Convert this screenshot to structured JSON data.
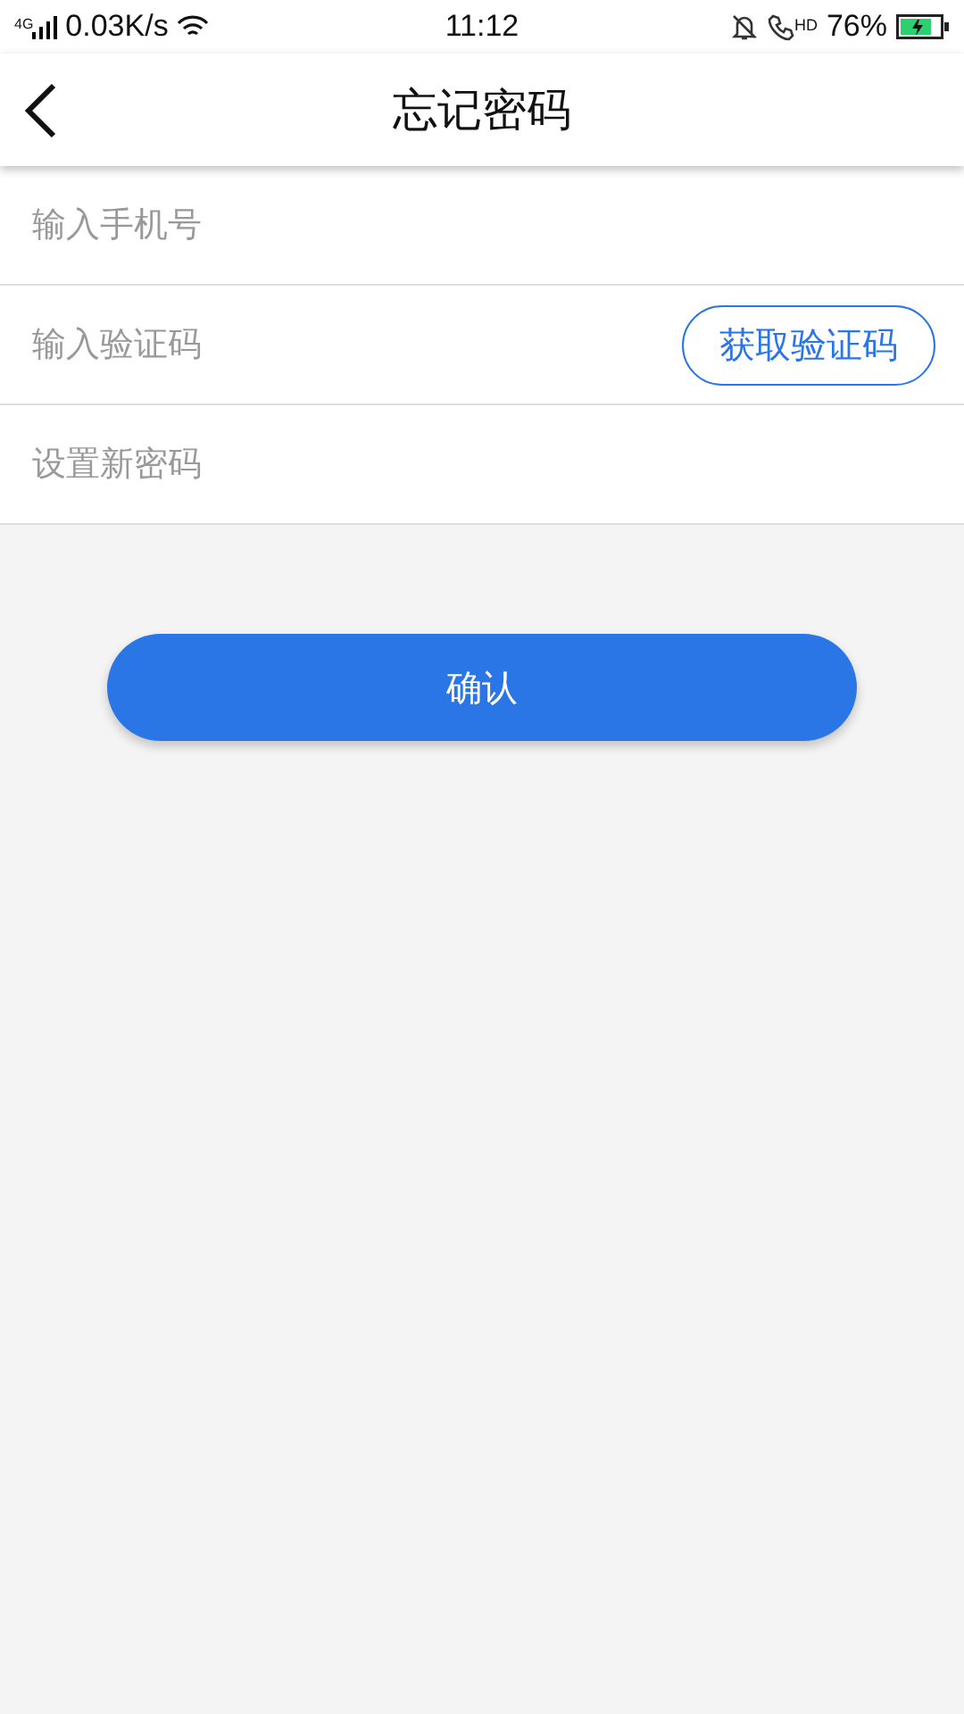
{
  "status_bar": {
    "network": "4G",
    "speed": "0.03K/s",
    "time": "11:12",
    "call_badge": "HD",
    "battery": "76%"
  },
  "header": {
    "title": "忘记密码"
  },
  "fields": [
    {
      "kind": "text",
      "placeholder": "输入手机号"
    },
    {
      "kind": "code",
      "placeholder": "输入验证码",
      "action": "获取验证码"
    },
    {
      "kind": "text",
      "placeholder": "设置新密码"
    }
  ],
  "confirm_button": "确认"
}
